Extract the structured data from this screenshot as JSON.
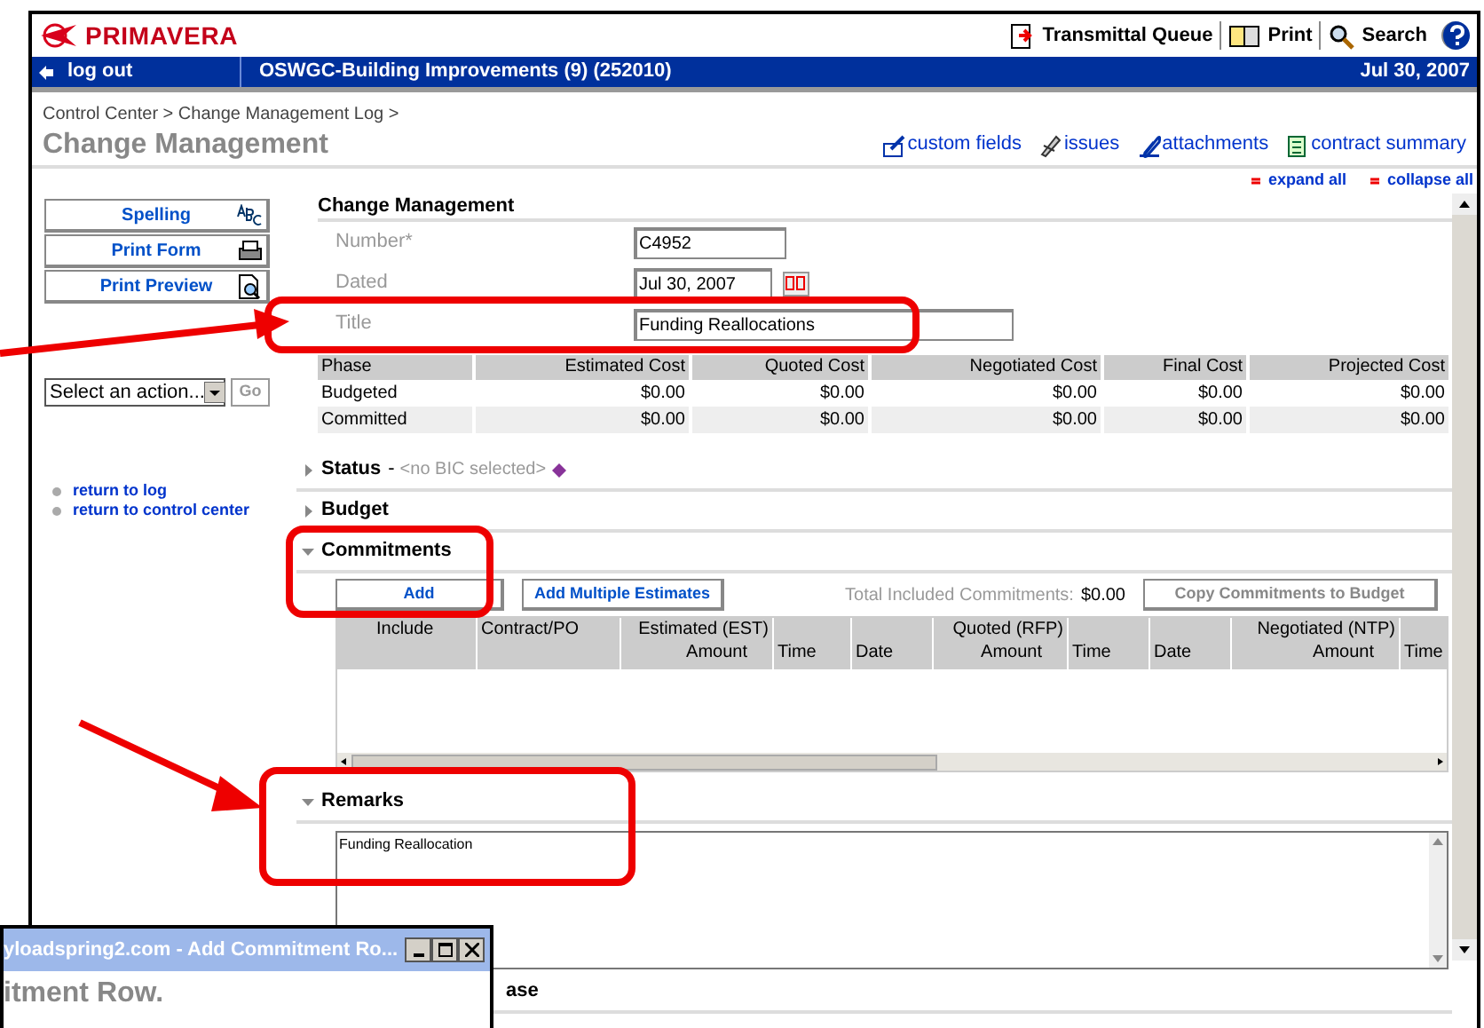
{
  "header": {
    "logo": "PRIMAVERA",
    "links": [
      {
        "label": "Transmittal Queue",
        "kind": "queue"
      },
      {
        "label": "Print",
        "kind": "print"
      },
      {
        "label": "Search",
        "kind": "search"
      }
    ]
  },
  "nav_bar": {
    "logout": "log out",
    "project": "OSWGC-Building Improvements (9) (252010)",
    "date": "Jul 30, 2007"
  },
  "breadcrumb": "Control Center > Change Management Log >",
  "page_title": "Change Management",
  "toolbar_links": [
    {
      "label": "custom fields",
      "kind": "custom"
    },
    {
      "label": "issues",
      "kind": "issues"
    },
    {
      "label": "attachments",
      "kind": "attach"
    },
    {
      "label": "contract summary",
      "kind": "summary"
    }
  ],
  "side_buttons": [
    {
      "label": "Spelling",
      "kind": "spell"
    },
    {
      "label": "Print Form",
      "kind": "print"
    },
    {
      "label": "Print Preview",
      "kind": "preview"
    }
  ],
  "action_select": {
    "value": "Select an action...",
    "button": "Go"
  },
  "side_links": [
    "return to log",
    "return to control center"
  ],
  "expand_links": [
    "expand all",
    "collapse all"
  ],
  "form": {
    "title": "Change Management",
    "fields": [
      {
        "label": "Number*",
        "value": "C4952",
        "kind": "short"
      },
      {
        "label": "Dated",
        "value": "Jul 30, 2007",
        "kind": "date"
      },
      {
        "label": "Title",
        "value": "Funding Reallocations",
        "kind": "text"
      }
    ]
  },
  "cost_table": {
    "columns": [
      "Phase",
      "Estimated Cost",
      "Quoted Cost",
      "Negotiated Cost",
      "Final Cost",
      "Projected Cost"
    ],
    "rows": [
      [
        "Budgeted",
        "$0.00",
        "$0.00",
        "$0.00",
        "$0.00",
        "$0.00"
      ],
      [
        "Committed",
        "$0.00",
        "$0.00",
        "$0.00",
        "$0.00",
        "$0.00"
      ]
    ]
  },
  "sections": [
    {
      "title": "Status",
      "kind": "status",
      "expanded": false,
      "dash": "-",
      "note": "<no BIC selected>"
    },
    {
      "title": "Budget",
      "kind": "plain",
      "expanded": false
    },
    {
      "title": "Commitments",
      "kind": "commitments",
      "expanded": true,
      "buttons": [
        "Add",
        "Add Multiple Estimates"
      ],
      "total_label": "Total Included Commitments:",
      "total": "$0.00",
      "copy_button": "Copy Commitments to Budget",
      "columns": [
        [
          "",
          "Include"
        ],
        [
          "",
          "Contract/PO"
        ],
        [
          "Estimated (EST)",
          "Amount"
        ],
        [
          "",
          "Time"
        ],
        [
          "",
          "Date"
        ],
        [
          "Quoted (RFP)",
          "Amount"
        ],
        [
          "",
          "Time"
        ],
        [
          "",
          "Date"
        ],
        [
          "Negotiated (NTP)",
          "Amount"
        ],
        [
          "",
          "Time"
        ]
      ]
    },
    {
      "title": "Remarks",
      "kind": "remarks",
      "expanded": true,
      "text": "Funding Reallocation"
    }
  ],
  "hidden_section": "ase",
  "popup": {
    "title": "yloadspring2.com - Add Commitment Ro...",
    "heading": "itment Row."
  }
}
